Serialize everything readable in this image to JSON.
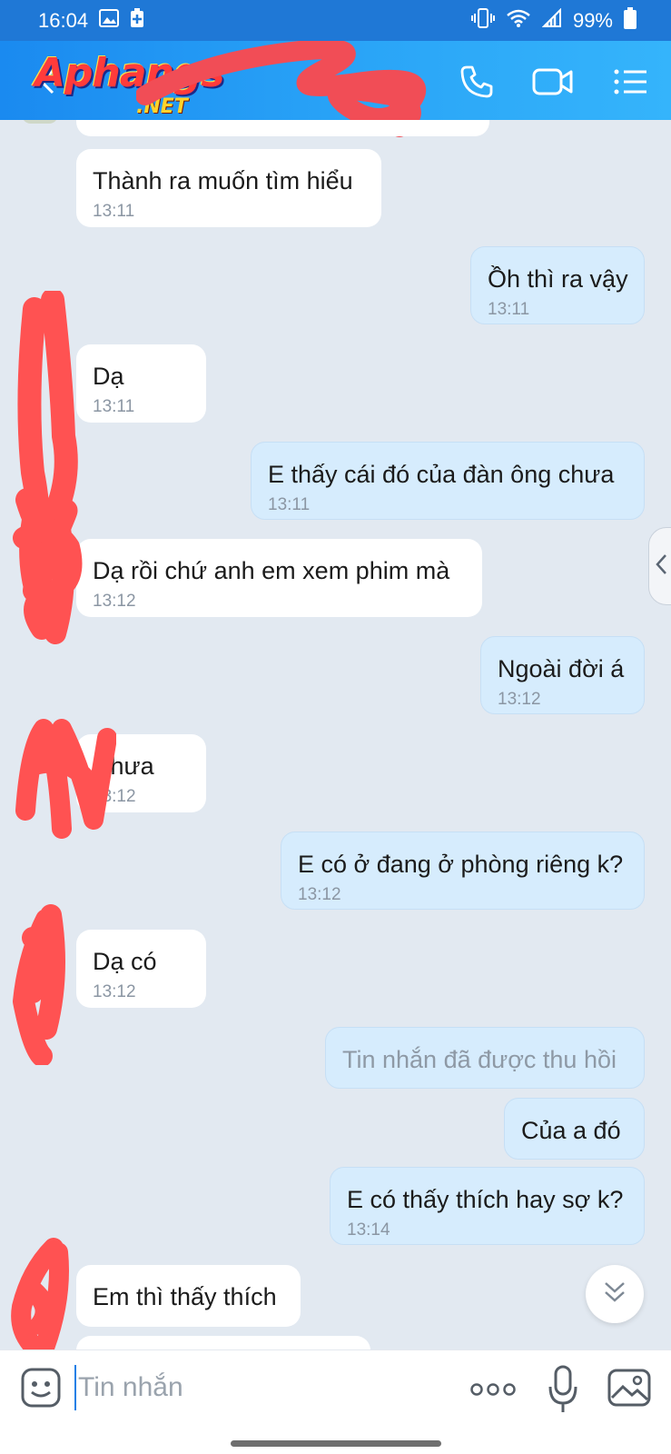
{
  "status_bar": {
    "time": "16:04",
    "battery": "99%"
  },
  "header": {
    "brand": "Aphangs",
    "brand_sub": ".NET",
    "icons": [
      "back-icon",
      "phone-icon",
      "video-call-icon",
      "menu-icon"
    ]
  },
  "messages": [
    {
      "dir": "in",
      "text": "Thành ra muốn tìm hiểu",
      "time": "13:11"
    },
    {
      "dir": "out",
      "text": "Ồh thì ra vậy",
      "time": "13:11"
    },
    {
      "dir": "in",
      "text": "Dạ",
      "time": "13:11"
    },
    {
      "dir": "out",
      "text": "E thấy cái đó của đàn ông chưa",
      "time": "13:11"
    },
    {
      "dir": "in",
      "text": "Dạ rồi chứ anh em xem phim mà",
      "time": "13:12"
    },
    {
      "dir": "out",
      "text": "Ngoài đời á",
      "time": "13:12"
    },
    {
      "dir": "in",
      "text": "Chưa",
      "time": "13:12"
    },
    {
      "dir": "out",
      "text": "E có ở đang ở phòng riêng k?",
      "time": "13:12"
    },
    {
      "dir": "in",
      "text": "Dạ có",
      "time": "13:12"
    },
    {
      "dir": "out",
      "text": "Tin nhắn đã được thu hồi",
      "time": ""
    },
    {
      "dir": "out",
      "text": "Của a đó",
      "time": ""
    },
    {
      "dir": "out",
      "text": "E có thấy thích hay sợ k?",
      "time": "13:14"
    },
    {
      "dir": "in",
      "text": "Em thì thấy thích",
      "time": ""
    }
  ],
  "input": {
    "placeholder": "Tin nhắn"
  },
  "colors": {
    "header": "#1a8af0",
    "chat_bg": "#e2e9f1",
    "bubble_in": "#ffffff",
    "bubble_out": "#d6ecfd",
    "redaction": "#ff5252"
  }
}
